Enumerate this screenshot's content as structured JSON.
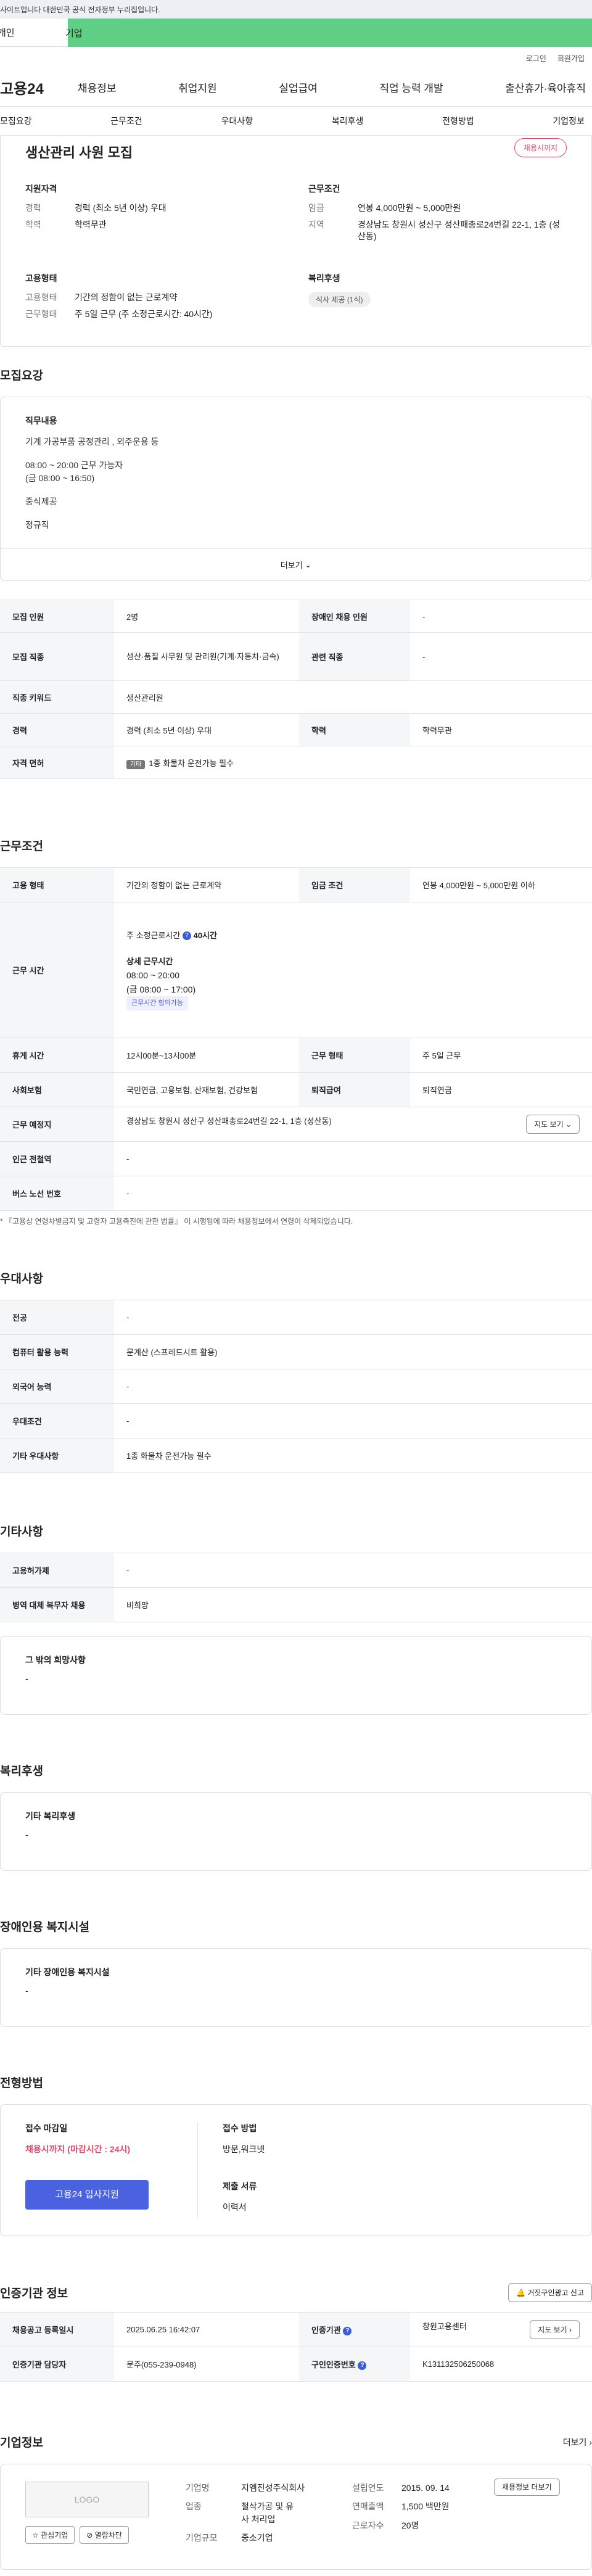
{
  "gov_notice": "사이트입니다 대한민국 공식 전자정부 누리집입니다.",
  "top_tabs": [
    "개인",
    "기업"
  ],
  "util_links": [
    "로그인",
    "회원가입"
  ],
  "logo": "고용24",
  "gnb": [
    "채용정보",
    "취업지원",
    "실업급여",
    "직업 능력 개발",
    "출산휴가·육아휴직"
  ],
  "subnav": [
    "모집요강",
    "근무조건",
    "우대사항",
    "복리후생",
    "전형방법",
    "기업정보"
  ],
  "summary": {
    "title": "생산관리 사원 모집",
    "badge": "채용시까지",
    "qual_title": "지원자격",
    "qual": [
      {
        "k": "경력",
        "v": "경력 (최소 5년 이상) 우대"
      },
      {
        "k": "학력",
        "v": "학력무관"
      }
    ],
    "cond_title": "근무조건",
    "cond": [
      {
        "k": "임금",
        "v": "연봉 4,000만원 ~ 5,000만원"
      },
      {
        "k": "지역",
        "v": "경상남도 창원시 성산구 성산패총로24번길 22-1, 1층 (성산동)"
      }
    ],
    "emp_title": "고용형태",
    "emp": [
      {
        "k": "고용형태",
        "v": "기간의 정함이 없는 근로계약"
      },
      {
        "k": "근무형태",
        "v": "주 5일 근무 (주 소정근로시간: 40시간)"
      }
    ],
    "welfare_title": "복리후생",
    "welfare_pill": "식사 제공 (1식)"
  },
  "recruit": {
    "title": "모집요강",
    "duty_title": "직무내용",
    "duty_lines": [
      "기계 가공부품 공정관리 , 외주운용 등",
      "",
      "08:00 ~ 20:00 근무 가능자",
      "(금 08:00 ~ 16:50)",
      "",
      "중식제공",
      "",
      "정규직"
    ],
    "more": "더보기",
    "rows": [
      [
        "모집 인원",
        "2명",
        "장애인 채용 인원",
        "-"
      ],
      [
        "모집 직종",
        "생산·품질 사무원 및 관리원(기계·자동차·금속)",
        "관련 직종",
        "-"
      ],
      [
        "직종 키워드",
        "생산관리원"
      ],
      [
        "경력",
        "경력 (최소 5년 이상) 우대",
        "학력",
        "학력무관"
      ],
      [
        "자격 면허",
        "1종 화물차 운전가능 필수"
      ]
    ],
    "license_tag": "기타"
  },
  "work": {
    "title": "근무조건",
    "emp_type_label": "고용 형태",
    "emp_type": "기간의 정함이 없는 근로계약",
    "wage_label": "임금 조건",
    "wage": "연봉 4,000만원 ~ 5,000만원 이하",
    "hours_label": "근무 시간",
    "hours_week": "주 소정근로시간",
    "hours_week_val": "40시간",
    "detail_title": "상세 근무시간",
    "detail_lines": [
      "08:00 ~ 20:00",
      "(금 08:00 ~ 17:00)"
    ],
    "flex_badge": "근무시간 협의가능",
    "break_label": "휴게 시간",
    "break": "12시00분~13시00분",
    "form_label": "근무 형태",
    "form": "주 5일 근무",
    "ins_label": "사회보험",
    "ins": "국민연금, 고용보험, 산재보험, 건강보험",
    "sev_label": "퇴직급여",
    "sev": "퇴직연금",
    "place_label": "근무 예정지",
    "place": "경상남도 창원시 성산구 성산패총로24번길 22-1, 1층 (성산동)",
    "map_btn": "지도 보기",
    "subway_label": "인근 전철역",
    "subway": "-",
    "bus_label": "버스 노선 번호",
    "bus": "-",
    "note": "* 『고용상 연령차별금지 및 고령자 고용촉진에 관한 법률』 이 시행됨에 따라 채용정보에서 연령이 삭제되었습니다."
  },
  "pref": {
    "title": "우대사항",
    "rows": [
      [
        "전공",
        "-"
      ],
      [
        "컴퓨터 활용 능력",
        "문계산 (스프레드시트 활용)"
      ],
      [
        "외국어 능력",
        "-"
      ],
      [
        "우대조건",
        "-"
      ],
      [
        "기타 우대사항",
        "1종 화물차 운전가능 필수"
      ]
    ]
  },
  "etc": {
    "title": "기타사항",
    "rows": [
      [
        "고용허가제",
        "-"
      ],
      [
        "병역 대체 복무자 채용",
        "비희망"
      ]
    ],
    "box_title": "그 밖의 희망사항",
    "box_val": "-"
  },
  "welfare": {
    "title": "복리후생",
    "box_title": "기타 복리후생",
    "box_val": "-"
  },
  "disab": {
    "title": "장애인용 복지시설",
    "box_title": "기타 장애인용 복지시설",
    "box_val": "-"
  },
  "process": {
    "title": "전형방법",
    "deadline_title": "접수 마감일",
    "deadline": "채용시까지 (마감시간 : 24시)",
    "apply_btn": "고용24 입사지원",
    "method_title": "접수 방법",
    "method": "방문,워크넷",
    "docs_title": "제출 서류",
    "docs": "이력서"
  },
  "cert": {
    "title": "인증기관 정보",
    "report_btn": "거짓구인광고 신고",
    "reg_label": "채용공고 등록일시",
    "reg": "2025.06.25 16:42:07",
    "org_label": "인증기관",
    "org": "창원고용센터",
    "map_btn": "지도 보기",
    "mgr_label": "인증기관 담당자",
    "mgr": "문주(055-239-0948)",
    "no_label": "구인인증번호",
    "no": "K131132506250068"
  },
  "company": {
    "title": "기업정보",
    "more": "더보기",
    "logo_text": "LOGO",
    "fav_btn": "관심기업",
    "block_btn": "열람차단",
    "fields": [
      [
        "기업명",
        "지엠진성주식회사"
      ],
      [
        "업종",
        "철삭가공 및 유사 처리업"
      ],
      [
        "기업규모",
        "중소기업"
      ]
    ],
    "fields2": [
      [
        "설립연도",
        "2015. 09. 14"
      ],
      [
        "연매출액",
        "1,500 백만원"
      ],
      [
        "근로자수",
        "20명"
      ]
    ],
    "jobs_btn": "채용정보 더보기"
  }
}
